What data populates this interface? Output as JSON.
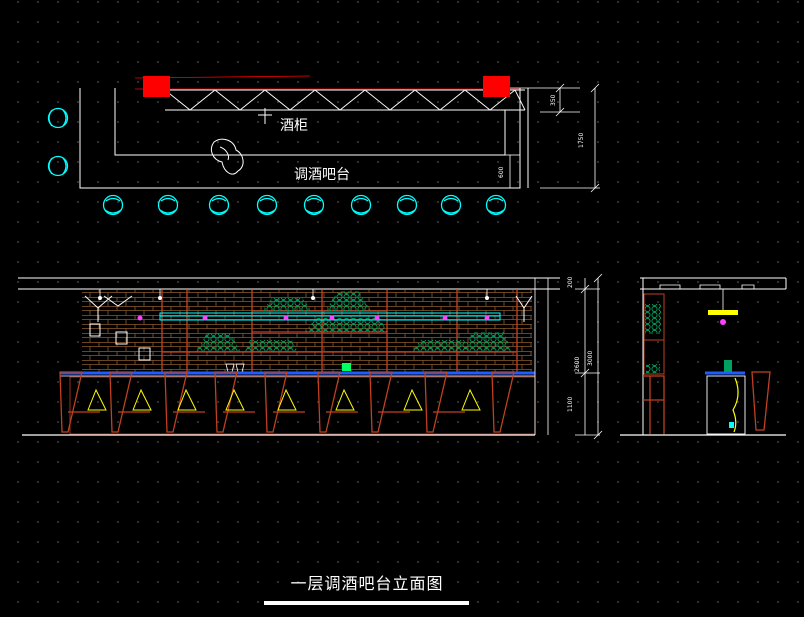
{
  "drawing": {
    "title": "一层调酒吧台立面图"
  },
  "plan_view": {
    "wine_cabinet_label": "酒柜",
    "bar_counter_label": "调酒吧台",
    "dimensions": [
      "350",
      "1750",
      "600"
    ]
  },
  "front_elevation": {
    "dimensions": [
      "200",
      "2600",
      "3000",
      "1100"
    ]
  },
  "colors": {
    "background": "#000000",
    "grid_dot": "#3a3a3a",
    "linework": "#ffffff",
    "column_red": "#ff0000",
    "stool_cyan": "#00ffff",
    "brick_brown": "#8b5a2b",
    "bottle_green": "#00a060",
    "lamp_magenta": "#ff40ff",
    "counter_blue": "#1e5cff",
    "stool_frame": "#c04020",
    "accent_yellow": "#ffff00"
  }
}
